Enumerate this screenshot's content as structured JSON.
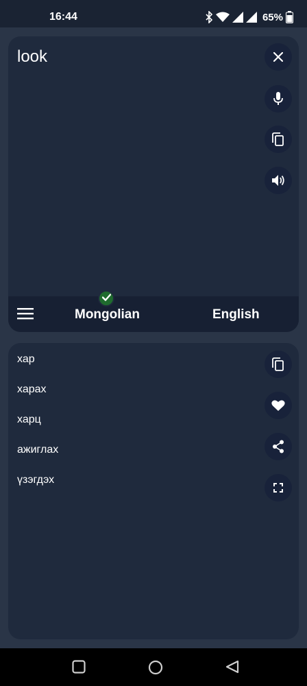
{
  "status_bar": {
    "time": "16:44",
    "battery": "65%",
    "icons": [
      "bluetooth-icon",
      "wifi-icon",
      "signal-icon",
      "signal-icon",
      "battery-icon"
    ]
  },
  "input": {
    "text": "look",
    "actions": [
      "close-icon",
      "microphone-icon",
      "copy-icon",
      "speaker-icon"
    ]
  },
  "language_bar": {
    "source": "Mongolian",
    "target": "English",
    "menu_icon": "hamburger-menu-icon",
    "verified_icon": "check-icon"
  },
  "output": {
    "results": [
      "хар",
      "харах",
      "харц",
      "ажиглах",
      "үзэгдэх"
    ],
    "actions": [
      "copy-icon",
      "heart-icon",
      "share-icon",
      "fullscreen-icon"
    ]
  },
  "nav_bar": {
    "buttons": [
      "recents-icon",
      "home-icon",
      "back-icon"
    ]
  },
  "colors": {
    "background": "#2a3547",
    "card": "#1f2a3d",
    "button": "#18223a",
    "check": "#1f6b2e"
  }
}
